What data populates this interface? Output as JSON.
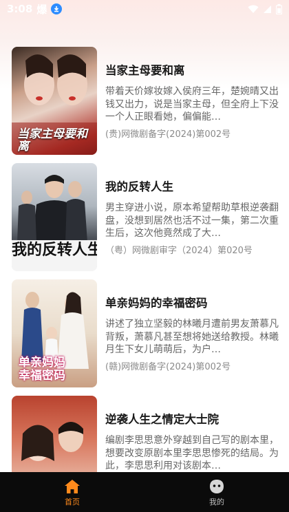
{
  "status_bar": {
    "time": "3:08",
    "app_glyph": "爆",
    "icons": [
      "download-icon",
      "wifi-icon",
      "signal-icon",
      "battery-icon"
    ]
  },
  "dramas": [
    {
      "title": "当家主母要和离",
      "description": "带着天价嫁妆嫁入侯府三年，楚婉晴又出钱又出力，说是当家主母，但全府上下没一个人正眼看她，偏偏能…",
      "license": "(贵)网微剧备字(2024)第002号",
      "poster_text": "当家主母要和离"
    },
    {
      "title": "我的反转人生",
      "description": "男主穿进小说，原本希望帮助草根逆袭翻盘，没想到居然也活不过一集，第二次重生后，这次他竟然成了大…",
      "license": "（粤）网微剧审字（2024）第020号",
      "poster_text": "我的反转人生"
    },
    {
      "title": "单亲妈妈的幸福密码",
      "description": "讲述了独立坚毅的林曦月遭前男友萧慕凡背叛，萧慕凡甚至想将她送给教授。林曦月生下女儿萌萌后，为户…",
      "license": "(赣)网微剧备字(2024)第002号",
      "poster_text": "单亲妈妈幸福密码"
    },
    {
      "title": "逆袭人生之情定大士院",
      "description": "编剧李思思意外穿越到自己写的剧本里，想要改变原剧本里李思思惨死的结局。为此，李思思利用对该剧本…",
      "license": "",
      "poster_text": ""
    }
  ],
  "tabbar": {
    "home_label": "首页",
    "mine_label": "我的",
    "accent_color": "#ff8a1c"
  }
}
